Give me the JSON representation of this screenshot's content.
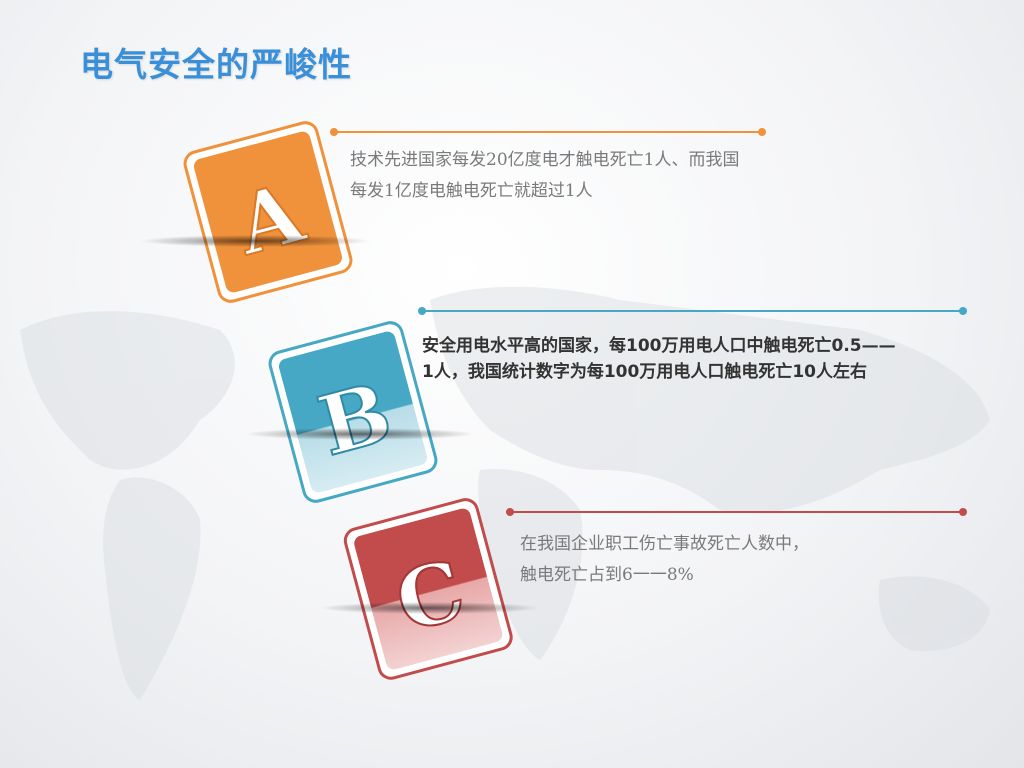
{
  "slide": {
    "title": "电气安全的严峻性"
  },
  "cards": [
    {
      "letter": "A",
      "color": "#f0913b"
    },
    {
      "letter": "B",
      "color": "#46a8c4"
    },
    {
      "letter": "C",
      "color": "#c24b4b"
    }
  ],
  "items": [
    {
      "lines": [
        "技术先进国家每发20亿度电才触电死亡1人、而我国",
        "每发1亿度电触电死亡就超过1人"
      ],
      "color": "#f0913b"
    },
    {
      "lines": [
        "安全用电水平高的国家，每100万用电人口中触电死亡0.5——",
        "1人，我国统计数字为每100万用电人口触电死亡10人左右"
      ],
      "color": "#46a8c4"
    },
    {
      "lines": [
        "在我国企业职工伤亡事故死亡人数中，",
        "触电死亡占到6一一8%"
      ],
      "color": "#c24b4b"
    }
  ]
}
